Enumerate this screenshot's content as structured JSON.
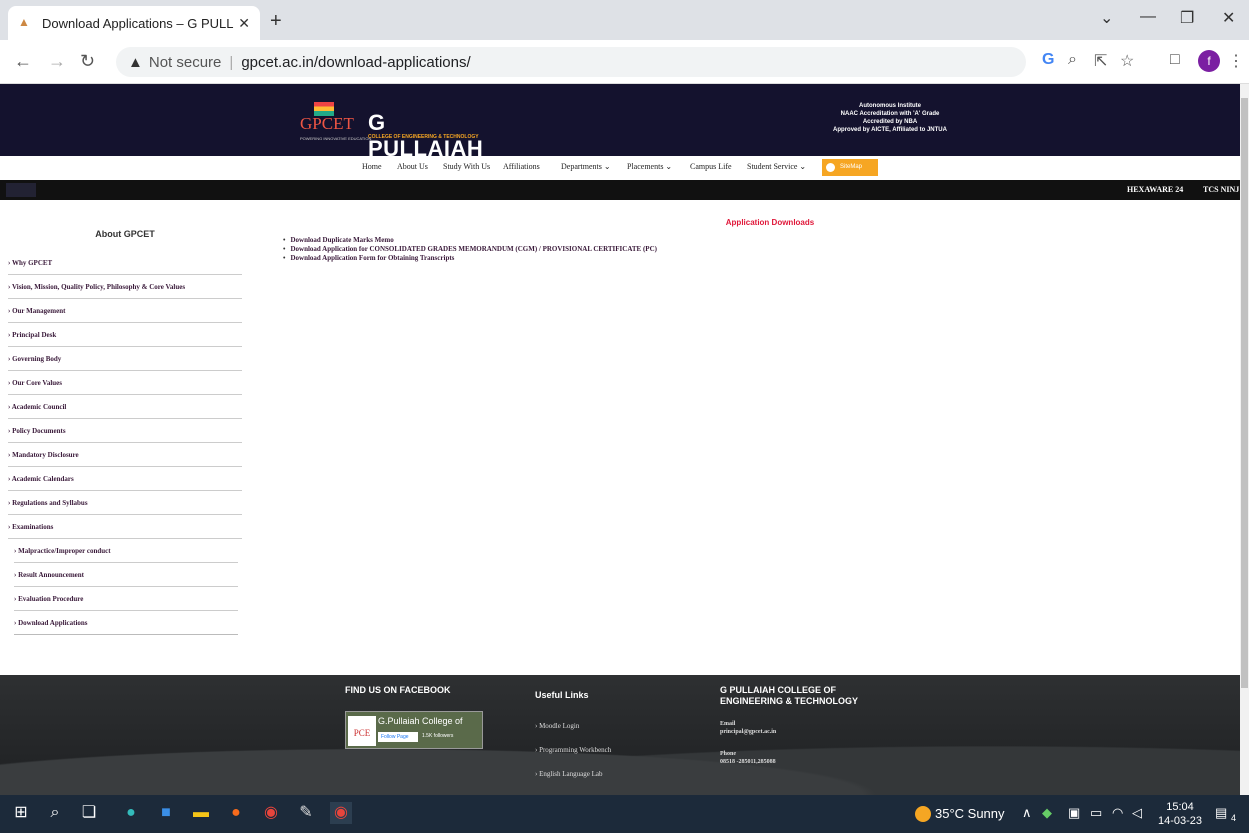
{
  "browser": {
    "tab_title": "Download Applications – G PULL",
    "new_tab": "+",
    "security": "Not secure",
    "url": "gpcet.ac.in/download-applications/",
    "profile_letter": "f"
  },
  "header": {
    "logo_short": "GPCET",
    "logo_tag": "POWERING INNOVATIVE EDUCATION",
    "name": "G PULLAIAH",
    "subname": "COLLEGE OF ENGINEERING & TECHNOLOGY",
    "accred": [
      "Autonomous Institute",
      "NAAC Accreditation with 'A' Grade",
      "Accredited by NBA",
      "Approved by AICTE, Affiliated to JNTUA"
    ]
  },
  "menu": [
    "Home",
    "About Us",
    "Study With Us",
    "Affiliations",
    "Departments ⌄",
    "Placements ⌄",
    "Campus Life",
    "Student Service ⌄"
  ],
  "sitemap": "SiteMap",
  "ticker": [
    "HEXAWARE 24",
    "TCS NINJ"
  ],
  "sidebar": {
    "title": "About GPCET",
    "items": [
      "› Why GPCET",
      "› Vision, Mission, Quality Policy, Philosophy & Core Values",
      "› Our Management",
      "› Principal Desk",
      "› Governing Body",
      "› Our Core Values",
      "› Academic Council",
      "› Policy Documents",
      "› Mandatory Disclosure",
      "› Academic Calendars",
      "› Regulations and Syllabus",
      "› Examinations"
    ],
    "subitems": [
      "› Malpractice/Improper conduct",
      "› Result Announcement",
      "› Evaluation Procedure",
      "› Download Applications"
    ]
  },
  "content": {
    "title": "Application Downloads",
    "links": [
      "Download Duplicate Marks Memo",
      "Download Application for CONSOLIDATED GRADES MEMORANDUM (CGM) / PROVISIONAL CERTIFICATE (PC)",
      "Download Application Form for Obtaining Transcripts"
    ]
  },
  "footer": {
    "facebook_head": "FIND US ON FACEBOOK",
    "fb_name": "G.Pullaiah College of",
    "fb_logo": "PCE",
    "fb_follow": "Follow Page",
    "fb_count": "1.5K followers",
    "useful_head": "Useful Links",
    "links": [
      "› Moodle Login",
      "› Programming Workbench",
      "› English Language Lab"
    ],
    "college_head": "G PULLAIAH COLLEGE OF ENGINEERING & TECHNOLOGY",
    "email_label": "Email",
    "email": "principal@gpcet.ac.in",
    "phone_label": "Phone",
    "phone": "08518 -285011,285088"
  },
  "taskbar": {
    "weather": "35°C  Sunny",
    "time": "15:04",
    "date": "14-03-23",
    "notif_count": "4"
  }
}
